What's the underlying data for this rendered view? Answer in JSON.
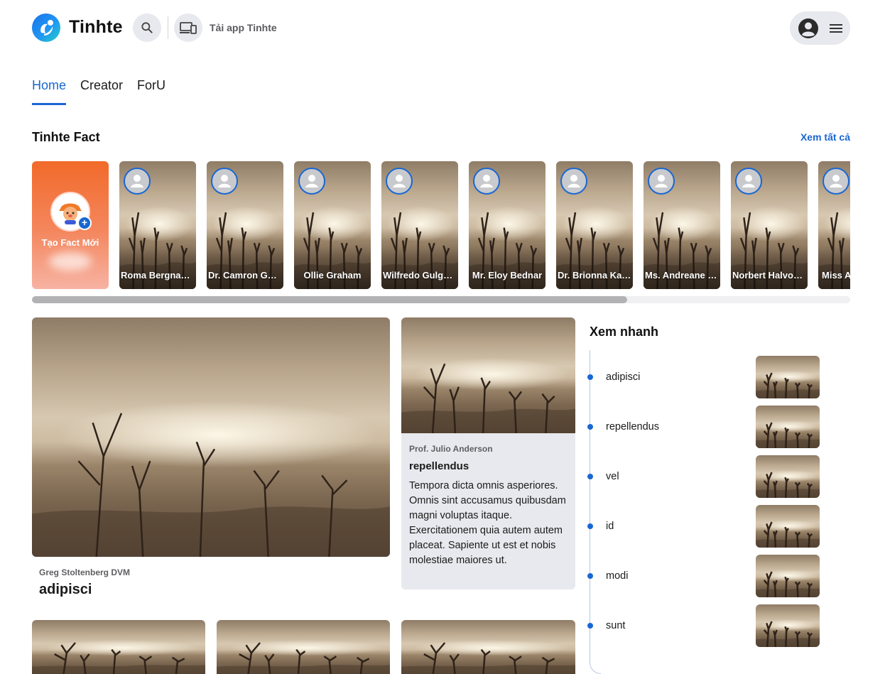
{
  "header": {
    "brand": "Tinhte",
    "search_icon": "search-icon",
    "app_label": "Tải app Tinhte",
    "app_icon": "devices-icon",
    "account_icon": "account-circle-icon",
    "menu_icon": "menu-icon"
  },
  "tabs": [
    {
      "label": "Home",
      "active": true
    },
    {
      "label": "Creator",
      "active": false
    },
    {
      "label": "ForU",
      "active": false
    }
  ],
  "fact": {
    "title": "Tinhte Fact",
    "see_all": "Xem tất cả",
    "create_label": "Tạo Fact Mới",
    "items": [
      {
        "name": "Roma Bergnaum"
      },
      {
        "name": "Dr. Camron Gusikowski"
      },
      {
        "name": "Ollie Graham"
      },
      {
        "name": "Wilfredo Gulgowski"
      },
      {
        "name": "Mr. Eloy Bednar"
      },
      {
        "name": "Dr. Brionna Kautzer"
      },
      {
        "name": "Ms. Andreane Hills"
      },
      {
        "name": "Norbert Halvorson"
      },
      {
        "name": "Miss Ashly"
      }
    ],
    "scroll_progress": 0.727
  },
  "main": {
    "hero": {
      "author": "Greg Stoltenberg DVM",
      "title": "adipisci"
    },
    "card": {
      "author": "Prof. Julio Anderson",
      "title": "repellendus",
      "excerpt": "Tempora dicta omnis asperiores. Omnis sint accusamus quibusdam magni voluptas itaque. Exercitationem quia autem autem placeat. Sapiente ut est et nobis molestiae maiores ut."
    }
  },
  "quick_view": {
    "title": "Xem nhanh",
    "items": [
      {
        "label": "adipisci"
      },
      {
        "label": "repellendus"
      },
      {
        "label": "vel"
      },
      {
        "label": "id"
      },
      {
        "label": "modi"
      },
      {
        "label": "sunt"
      }
    ]
  },
  "colors": {
    "accent": "#1967d2",
    "pill_bg": "#e8e9ee",
    "fact_create_bg": "#f26a2a"
  }
}
